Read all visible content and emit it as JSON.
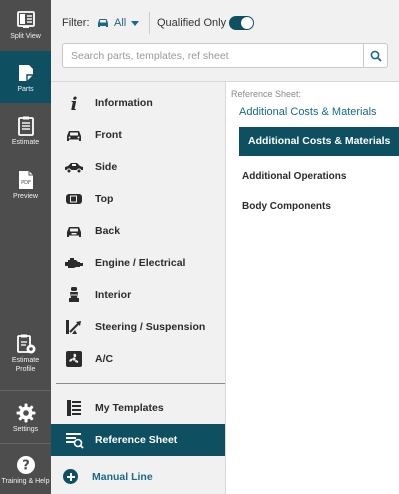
{
  "rail": {
    "items": [
      {
        "label": "Split View",
        "icon": "split-view-icon"
      },
      {
        "label": "Parts",
        "icon": "parts-icon",
        "active": true
      },
      {
        "label": "Estimate",
        "icon": "clipboard-icon"
      },
      {
        "label": "Preview",
        "icon": "pdf-icon",
        "icon_text": "PDF"
      },
      {
        "label": "Estimate Profile",
        "icon": "profile-gear-icon"
      },
      {
        "label": "Settings",
        "icon": "gear-icon"
      },
      {
        "label": "Training & Help",
        "icon": "help-icon"
      }
    ]
  },
  "topbar": {
    "filter_label": "Filter:",
    "filter_value": "All",
    "qualified_label": "Qualified Only",
    "qualified_on": true,
    "search_placeholder": "Search parts, templates, ref sheet"
  },
  "categories": [
    {
      "label": "Information",
      "icon": "info-icon"
    },
    {
      "label": "Front",
      "icon": "car-front-icon"
    },
    {
      "label": "Side",
      "icon": "car-side-icon"
    },
    {
      "label": "Top",
      "icon": "car-top-icon"
    },
    {
      "label": "Back",
      "icon": "car-back-icon"
    },
    {
      "label": "Engine / Electrical",
      "icon": "engine-icon"
    },
    {
      "label": "Interior",
      "icon": "seat-icon"
    },
    {
      "label": "Steering / Suspension",
      "icon": "steering-icon"
    },
    {
      "label": "A/C",
      "icon": "fan-icon"
    }
  ],
  "lower_categories": [
    {
      "label": "My Templates",
      "icon": "template-icon"
    },
    {
      "label": "Reference Sheet",
      "icon": "reference-sheet-icon",
      "selected": true
    }
  ],
  "manual_line": {
    "label": "Manual Line",
    "icon": "plus-circle-icon"
  },
  "reference": {
    "header": "Reference Sheet:",
    "subtitle": "Additional Costs & Materials",
    "selected_item": "Additional Costs & Materials",
    "items": [
      "Additional Operations",
      "Body Components"
    ]
  },
  "colors": {
    "accent": "#0e4f62",
    "link": "#1a6a8a",
    "rail_bg": "#4d4d4d",
    "pane_bg": "#f1f1f1"
  }
}
